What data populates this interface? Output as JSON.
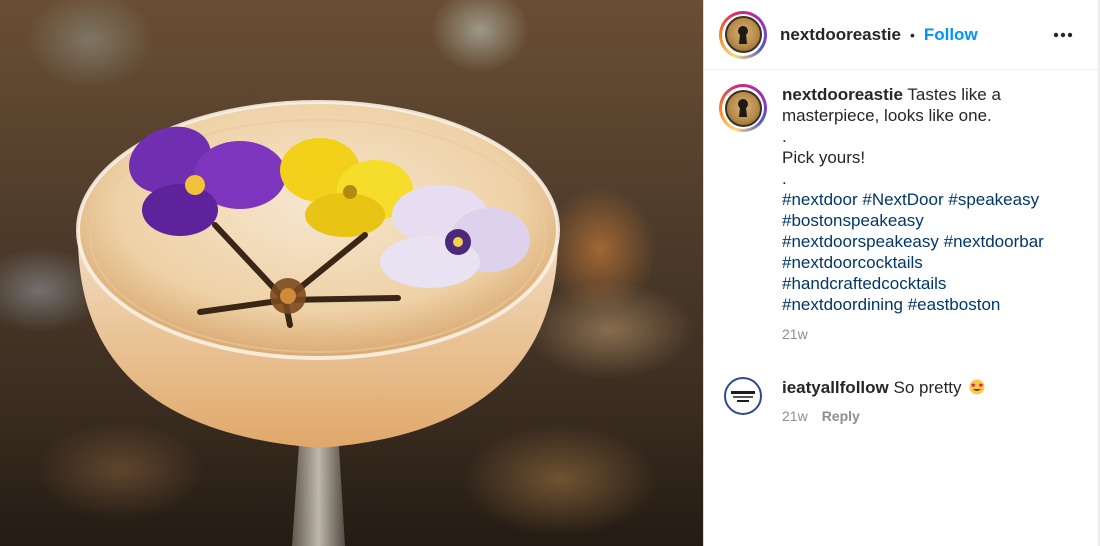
{
  "post": {
    "username": "nextdooreastie",
    "header_separator": "•",
    "follow_label": "Follow",
    "more_icon": "more-horizontal-icon",
    "image_alt": "Cocktail in a coupe glass garnished with edible flowers",
    "caption": {
      "username": "nextdooreastie",
      "text_line_1": "Tastes like a masterpiece, looks like one.",
      "dot_1": ".",
      "text_line_2": "Pick yours!",
      "dot_2": ".",
      "hashtags": [
        "#nextdoor",
        "#NextDoor",
        "#speakeasy",
        "#bostonspeakeasy",
        "#nextdoorspeakeasy",
        "#nextdoorbar",
        "#nextdoorcocktails",
        "#handcraftedcocktails",
        "#nextdoordining",
        "#eastboston"
      ],
      "time": "21w"
    }
  },
  "comments": [
    {
      "username": "ieatyallfollow",
      "text": "So pretty",
      "emoji": "heart-eyes-emoji",
      "time": "21w",
      "reply_label": "Reply"
    }
  ],
  "colors": {
    "follow_blue": "#0095f6",
    "hashtag_blue": "#00376b",
    "text": "#262626",
    "secondary": "#8e8e8e"
  }
}
